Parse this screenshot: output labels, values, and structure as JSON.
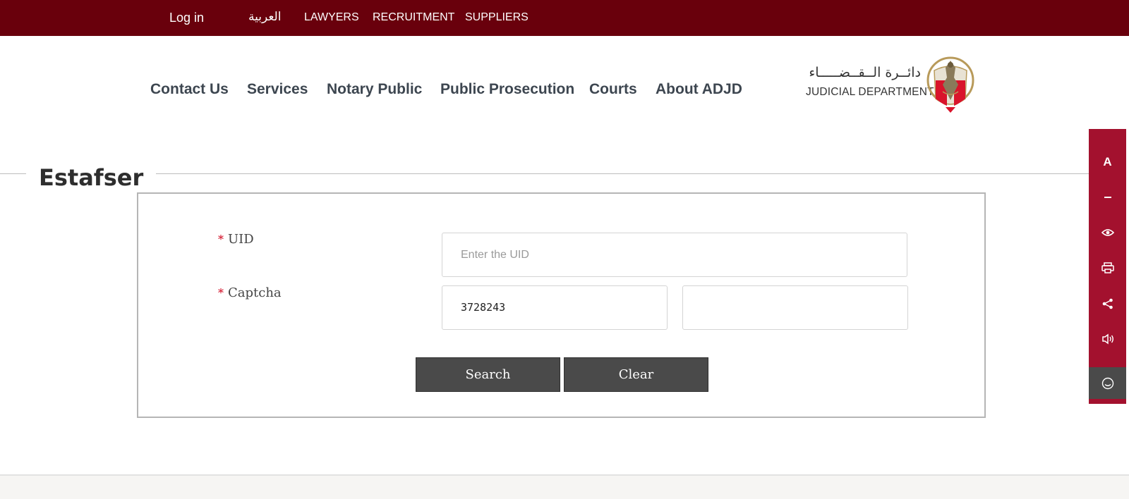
{
  "topbar": {
    "login": "Log in",
    "arabic": "العربية",
    "lawyers": "LAWYERS",
    "recruitment": "RECRUITMENT",
    "suppliers": "SUPPLIERS",
    "background_color": "#69000c"
  },
  "nav": {
    "contact": "Contact Us",
    "services": "Services",
    "notary": "Notary Public",
    "prosecution": "Public Prosecution",
    "courts": "Courts",
    "about": "About ADJD"
  },
  "logo": {
    "arabic": "دائــرة الــقــضـــــاء",
    "english": "JUDICIAL DEPARTMENT"
  },
  "page": {
    "title": "Estafser"
  },
  "form": {
    "uid_label": "UID",
    "uid_placeholder": "Enter the UID",
    "uid_value": "",
    "captcha_label": "Captcha",
    "captcha_code": "3728243",
    "captcha_value": "",
    "required_marker": "*",
    "search_label": "Search",
    "clear_label": "Clear"
  },
  "accessibility": {
    "font_label": "A",
    "background_color": "#a3112e",
    "icons": [
      "font-size-icon",
      "decrease-font-icon",
      "eye-icon",
      "print-icon",
      "share-icon",
      "sound-icon",
      "smile-icon"
    ]
  }
}
